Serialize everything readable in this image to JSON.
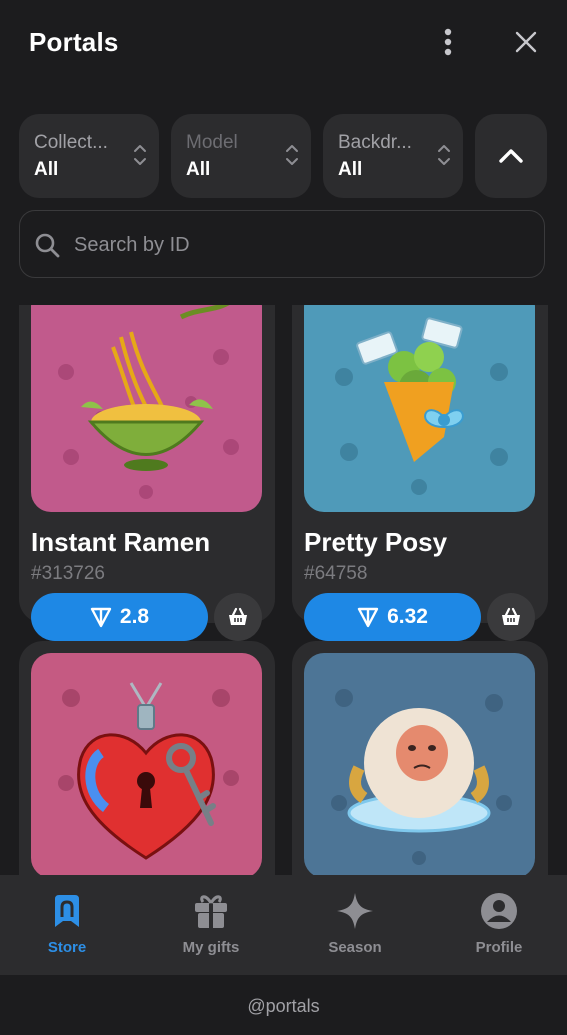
{
  "header": {
    "title": "Portals"
  },
  "filters": [
    {
      "label": "Collect...",
      "value": "All",
      "dim": false
    },
    {
      "label": "Model",
      "value": "All",
      "dim": true
    },
    {
      "label": "Backdr...",
      "value": "All",
      "dim": false
    }
  ],
  "search": {
    "placeholder": "Search by ID",
    "value": ""
  },
  "cards": [
    {
      "name": "Instant Ramen",
      "number": "#313726",
      "price": "2.8",
      "backdrop": "#c15a8c",
      "pattern_color": "#a94676",
      "icon": "ramen-bowl-icon"
    },
    {
      "name": "Pretty Posy",
      "number": "#64758",
      "price": "6.32",
      "backdrop": "#4f9ab9",
      "pattern_color": "#3f83a0",
      "icon": "bouquet-icon"
    },
    {
      "name": "",
      "number": "",
      "price": "",
      "backdrop": "#c55a82",
      "pattern_color": "#a8456a",
      "icon": "heart-lock-key-icon"
    },
    {
      "name": "",
      "number": "",
      "price": "",
      "backdrop": "#4d7596",
      "pattern_color": "#3f6381",
      "icon": "snow-monkey-icon"
    }
  ],
  "tabs": [
    {
      "label": "Store",
      "icon": "store-icon",
      "active": true
    },
    {
      "label": "My gifts",
      "icon": "gift-icon",
      "active": false
    },
    {
      "label": "Season",
      "icon": "sparkle-icon",
      "active": false
    },
    {
      "label": "Profile",
      "icon": "profile-icon",
      "active": false
    }
  ],
  "footer": {
    "handle": "@portals"
  },
  "colors": {
    "accent": "#1e88e5",
    "background": "#1c1c1e",
    "surface": "#2c2c2e"
  }
}
